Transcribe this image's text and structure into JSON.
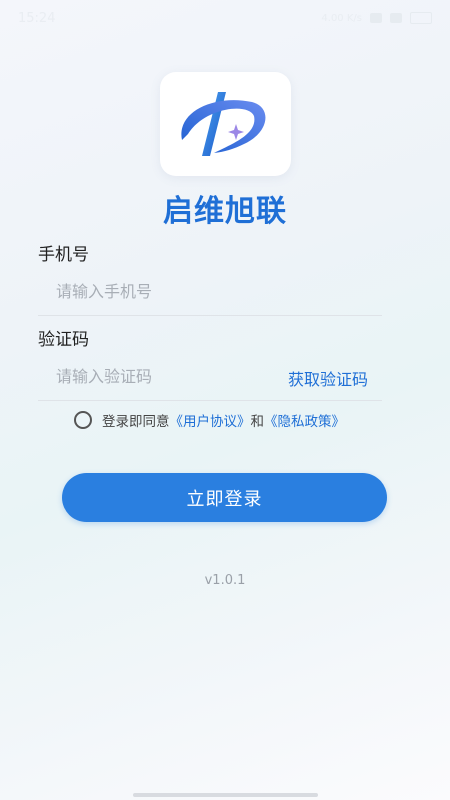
{
  "status_bar": {
    "time": "15:24",
    "indicators": "4.00 K/s"
  },
  "app": {
    "name": "启维旭联",
    "logo_icon": "stylized-d-logo-icon",
    "brand_color": "#1f6fd6"
  },
  "form": {
    "phone_label": "手机号",
    "phone_placeholder": "请输入手机号",
    "code_label": "验证码",
    "code_placeholder": "请输入验证码",
    "get_code_label": "获取验证码"
  },
  "agreement": {
    "prefix": "登录即同意",
    "user_agreement": "《用户协议》",
    "conjunction": "和",
    "privacy_policy": "《隐私政策》",
    "checked": false
  },
  "login_button_label": "立即登录",
  "version": "v1.0.1"
}
